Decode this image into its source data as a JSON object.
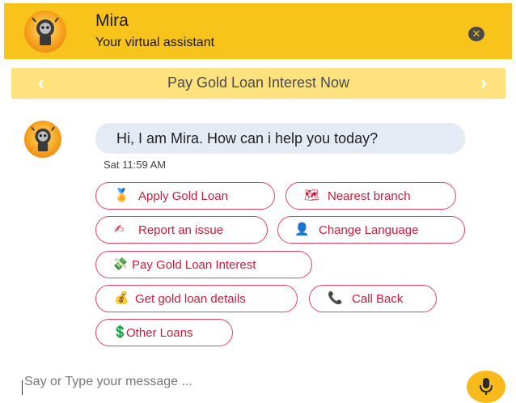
{
  "header": {
    "title": "Mira",
    "subtitle": "Your virtual assistant",
    "close_icon": "close-icon",
    "avatar_icon": "mira-avatar"
  },
  "banner": {
    "text": "Pay Gold Loan Interest Now",
    "prev_icon": "chevron-left-icon",
    "next_icon": "chevron-right-icon"
  },
  "conversation": {
    "bot_message": "Hi, I am Mira. How can i help you today?",
    "timestamp": "Sat 11:59 AM"
  },
  "quick_replies": [
    {
      "label": "Apply Gold Loan",
      "icon": "medal-icon",
      "glyph": "🏅"
    },
    {
      "label": "Nearest branch",
      "icon": "map-icon",
      "glyph": "🗺"
    },
    {
      "label": "Report an issue",
      "icon": "pencil-icon",
      "glyph": "✍"
    },
    {
      "label": "Change Language",
      "icon": "person-icon",
      "glyph": "👤"
    },
    {
      "label": "Pay Gold Loan Interest",
      "icon": "money-icon",
      "glyph": "💸"
    },
    {
      "label": "Get gold loan details",
      "icon": "money-bag-icon",
      "glyph": "💰"
    },
    {
      "label": "Call Back",
      "icon": "phone-icon",
      "glyph": "📞"
    },
    {
      "label": "Other Loans",
      "icon": "dollar-icon",
      "glyph": "💲"
    }
  ],
  "composer": {
    "placeholder": "Say or Type your message ...",
    "mic_icon": "microphone-icon"
  },
  "colors": {
    "header": "#f8c31b",
    "banner": "#fde27e",
    "chip_border": "#e64060",
    "chip_text": "#cc1b3b",
    "bubble": "#e4ebf5"
  }
}
